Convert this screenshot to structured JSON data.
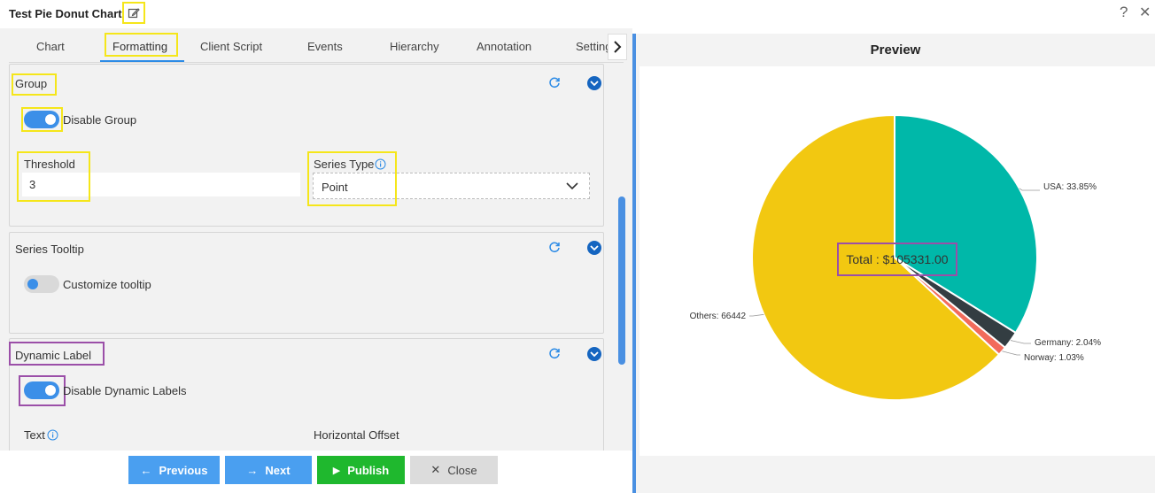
{
  "window": {
    "title": "Test Pie Donut Chart"
  },
  "tabs": [
    "Chart",
    "Formatting",
    "Client Script",
    "Events",
    "Hierarchy",
    "Annotation",
    "Settings"
  ],
  "group": {
    "title": "Group",
    "toggle_label": "Disable Group",
    "toggle_on": true,
    "threshold_label": "Threshold",
    "threshold_value": "3",
    "series_type_label": "Series Type",
    "series_type_value": "Point"
  },
  "series_tooltip": {
    "title": "Series Tooltip",
    "toggle_label": "Customize tooltip",
    "toggle_on": false
  },
  "dynamic_label": {
    "title": "Dynamic Label",
    "toggle_label": "Disable Dynamic Labels",
    "toggle_on": true,
    "text_label": "Text",
    "offset_label": "Horizontal Offset"
  },
  "footer": {
    "previous": "Previous",
    "next": "Next",
    "publish": "Publish",
    "close": "Close"
  },
  "preview": {
    "title": "Preview"
  },
  "colors": {
    "accent": "#2c8be6",
    "previous_btn": "#4a9ff0",
    "next_btn": "#4a9ff0",
    "publish_btn": "#1fb82e",
    "close_btn": "#dcdcdc",
    "highlight_yellow": "#f5e61a",
    "highlight_purple": "#9b4fa8"
  },
  "chart_data": {
    "type": "pie",
    "center_label": "Total : $105331.00",
    "slices": [
      {
        "label": "USA: 33.85%",
        "value": 33.85,
        "color": "#00b8a9"
      },
      {
        "label": "Germany: 2.04%",
        "value": 2.04,
        "color": "#333d42"
      },
      {
        "label": "Norway: 1.03%",
        "value": 1.03,
        "color": "#f26b5b"
      },
      {
        "label": "Others: 66442",
        "value": 63.08,
        "color": "#f2c811"
      }
    ]
  }
}
